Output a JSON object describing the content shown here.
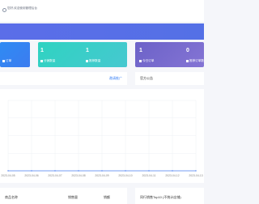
{
  "topbar": {
    "notice": "您好,欢迎使用管理后台"
  },
  "cards": {
    "blue": {
      "label": "订单"
    },
    "teal": {
      "left_value": "1",
      "left_label": "分销数量",
      "right_value": "1",
      "right_label": "推荐数量"
    },
    "purple": {
      "left_value": "1",
      "left_label": "今日订单",
      "right_value": "0",
      "right_label": "推荐订单数"
    }
  },
  "panels": {
    "left_link": "邀请推广",
    "right_title": "官方公告"
  },
  "chart_data": {
    "type": "line",
    "x": [
      "2023-04-05",
      "2023-04-06",
      "2023-04-07",
      "2023-04-08",
      "2023-04-09",
      "2023-04-10",
      "2023-04-11",
      "2023-04-12",
      "2023-04-13"
    ],
    "series": [
      {
        "values": [
          0,
          0,
          0,
          0,
          0,
          0,
          0,
          0,
          0
        ]
      }
    ],
    "grid": true,
    "line_color": "#4a7ef0"
  },
  "bottom": {
    "col1": "商品名称",
    "col2": "销售量",
    "col3": "销额",
    "right_title": "同行销售Top10 (不统计店铺)"
  }
}
